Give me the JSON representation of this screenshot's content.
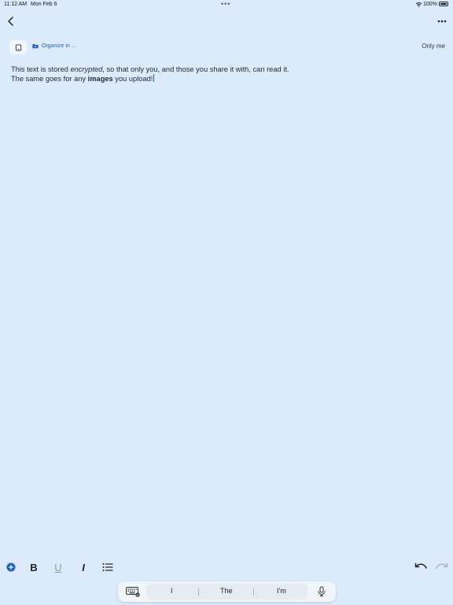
{
  "status_bar": {
    "time": "11:12 AM",
    "date": "Mon Feb 6",
    "battery": "100%",
    "icons": [
      "wifi-icon",
      "battery-icon",
      "multitasking-dots-icon"
    ]
  },
  "header": {
    "back_icon": "chevron-left-icon",
    "more_icon": "ellipsis-icon"
  },
  "meta_bar": {
    "organize_label": "Organize in ...",
    "share_status": "Only me",
    "device_icon": "tablet-icon",
    "folder_icon": "folder-icon"
  },
  "document": {
    "line1": {
      "before": "This text is stored ",
      "emphasis": "encrypted",
      "after": ", so that only you, and those you share it with, can read it."
    },
    "line2": {
      "before": "The same goes for any ",
      "strong": "images",
      "after": " you upload!"
    }
  },
  "format_toolbar": {
    "bold": "B",
    "underline": "U",
    "italic": "I",
    "icons": [
      "add-circle-icon",
      "list-icon",
      "undo-icon",
      "redo-icon"
    ]
  },
  "keyboard_bar": {
    "suggestions": [
      "I",
      "The",
      "I'm"
    ],
    "icons": [
      "keyboard-icon",
      "microphone-icon"
    ]
  },
  "colors": {
    "background": "#dcebfb",
    "accent": "#1f5fbf",
    "text": "#1c2733"
  }
}
